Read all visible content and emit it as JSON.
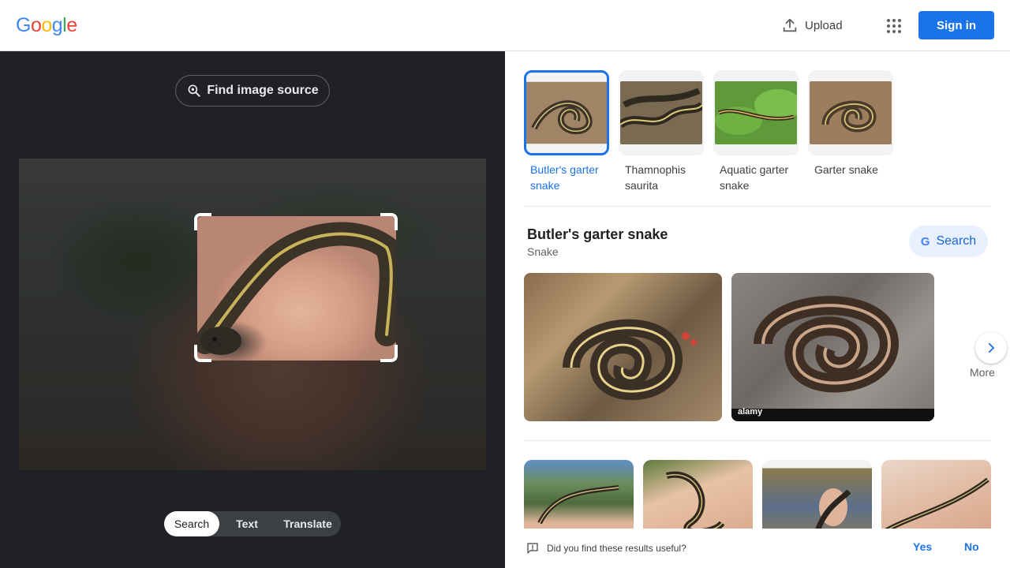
{
  "header": {
    "logo": {
      "letters": [
        "G",
        "o",
        "o",
        "g",
        "l",
        "e"
      ],
      "colors": [
        "#4285f4",
        "#ea4335",
        "#fbbc05",
        "#4285f4",
        "#34a853",
        "#ea4335"
      ]
    },
    "upload_label": "Upload",
    "signin_label": "Sign in",
    "icons": {
      "upload": "upload-icon",
      "apps": "apps-grid-icon"
    }
  },
  "left": {
    "find_source_label": "Find image source",
    "mode_tabs": [
      {
        "label": "Search",
        "active": true
      },
      {
        "label": "Text",
        "active": false
      },
      {
        "label": "Translate",
        "active": false
      }
    ]
  },
  "right": {
    "chips": [
      {
        "label": "Butler's garter snake",
        "selected": true
      },
      {
        "label": "Thamnophis saurita",
        "selected": false
      },
      {
        "label": "Aquatic garter snake",
        "selected": false
      },
      {
        "label": "Garter snake",
        "selected": false
      }
    ],
    "entity": {
      "title": "Butler's garter snake",
      "subtitle": "Snake",
      "search_label": "Search"
    },
    "more_label": "More",
    "watermark": "alamy",
    "feedback": {
      "question": "Did you find these results useful?",
      "yes": "Yes",
      "no": "No"
    }
  },
  "colors": {
    "accent": "#1a73e8",
    "left_bg": "#202124"
  }
}
